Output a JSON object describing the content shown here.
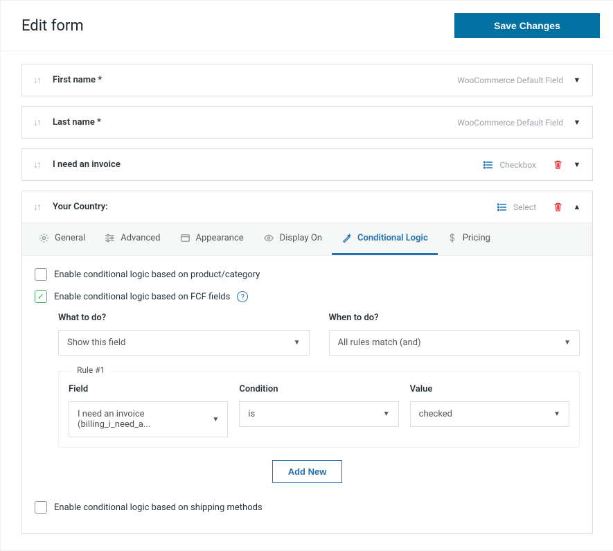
{
  "header": {
    "title": "Edit form",
    "save_button": "Save Changes"
  },
  "fields": [
    {
      "label": "First name *",
      "type_label": "WooCommerce Default Field",
      "show_list_icon": false,
      "show_trash": false,
      "expanded": false
    },
    {
      "label": "Last name *",
      "type_label": "WooCommerce Default Field",
      "show_list_icon": false,
      "show_trash": false,
      "expanded": false
    },
    {
      "label": "I need an invoice",
      "type_label": "Checkbox",
      "show_list_icon": true,
      "show_trash": true,
      "expanded": false
    },
    {
      "label": "Your Country:",
      "type_label": "Select",
      "show_list_icon": true,
      "show_trash": true,
      "expanded": true
    }
  ],
  "tabs": {
    "general": "General",
    "advanced": "Advanced",
    "appearance": "Appearance",
    "display_on": "Display On",
    "conditional_logic": "Conditional Logic",
    "pricing": "Pricing"
  },
  "conditional": {
    "enable_product": "Enable conditional logic based on product/category",
    "enable_fcf": "Enable conditional logic based on FCF fields",
    "enable_shipping": "Enable conditional logic based on shipping methods",
    "what_to_do_label": "What to do?",
    "what_to_do_value": "Show this field",
    "when_to_do_label": "When to do?",
    "when_to_do_value": "All rules match (and)",
    "rule_legend": "Rule #1",
    "field_label": "Field",
    "field_value": "I need an invoice (billing_i_need_a...",
    "condition_label": "Condition",
    "condition_value": "is",
    "value_label": "Value",
    "value_value": "checked",
    "add_new": "Add New"
  }
}
